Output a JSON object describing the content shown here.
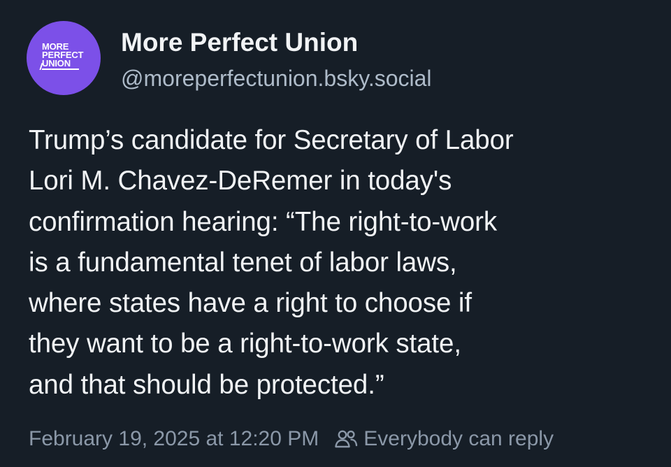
{
  "author": {
    "avatar_logo_lines": [
      "MORE",
      "PERFECT",
      "UNION"
    ],
    "display_name": "More Perfect Union",
    "handle": "@moreperfectunion.bsky.social",
    "avatar_color": "#7c50e8"
  },
  "post": {
    "text": "Trump’s candidate for Secretary of Labor\nLori M. Chavez-DeRemer in today's\nconfirmation hearing: “The right-to-work\nis a fundamental tenet of labor laws,\nwhere states have a right to choose if\nthey want to be a right-to-work state,\nand that should be protected.”"
  },
  "meta": {
    "timestamp": "February 19, 2025 at 12:20 PM",
    "reply_setting_icon": "people-icon",
    "reply_setting": "Everybody can reply"
  },
  "theme": {
    "background": "#161e27",
    "text": "#f1f3f5",
    "muted": "#8b98a8"
  }
}
